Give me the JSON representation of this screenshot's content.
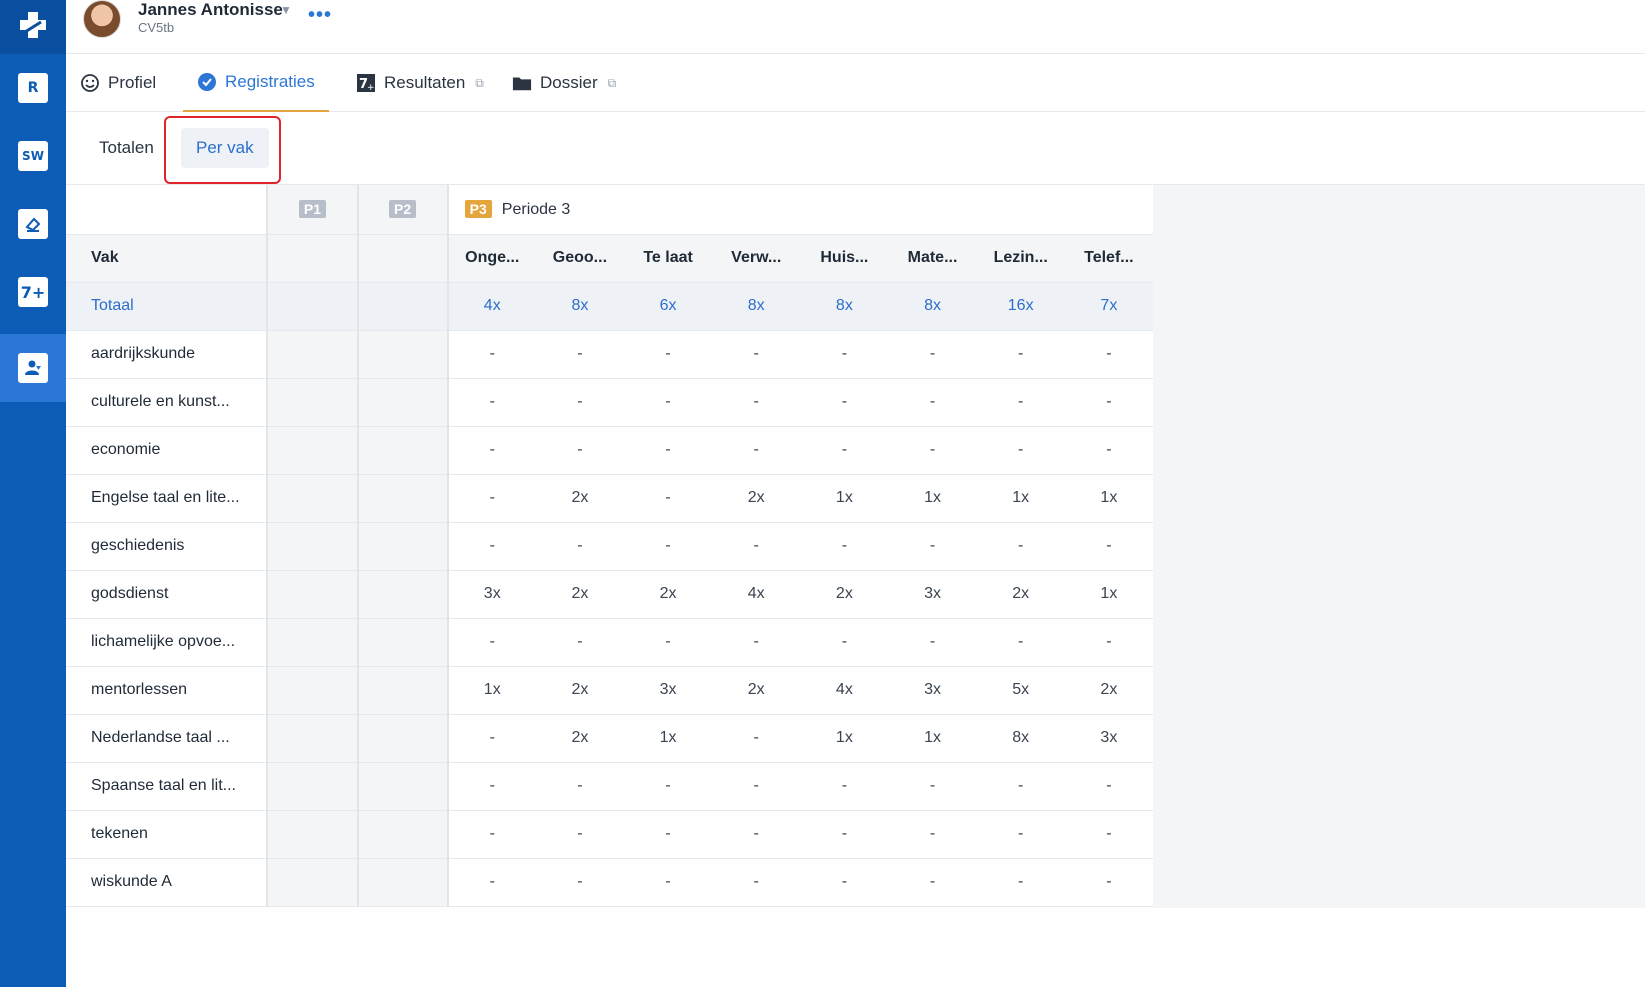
{
  "header": {
    "user_name": "Jannes Antonisse",
    "user_class": "CV5tb",
    "more": "•••"
  },
  "rail": {
    "items": [
      {
        "name": "logo-icon"
      },
      {
        "name": "roster-icon",
        "label": "R"
      },
      {
        "name": "sw-icon",
        "label": "SW"
      },
      {
        "name": "eraser-icon"
      },
      {
        "name": "grades-icon",
        "label": "7+"
      },
      {
        "name": "students-icon"
      }
    ]
  },
  "tabs": [
    {
      "label": "Profiel",
      "icon": "smiley-icon"
    },
    {
      "label": "Registraties",
      "icon": "check-circle-icon"
    },
    {
      "label": "Resultaten",
      "icon": "grades-icon"
    },
    {
      "label": "Dossier",
      "icon": "folder-icon"
    }
  ],
  "subtabs": [
    {
      "label": "Totalen"
    },
    {
      "label": "Per vak"
    }
  ],
  "table": {
    "periods": {
      "p1": "P1",
      "p2": "P2",
      "p3": "P3",
      "p3_label": "Periode 3"
    },
    "vak_header": "Vak",
    "columns": [
      "Onge...",
      "Geoo...",
      "Te laat",
      "Verw...",
      "Huis...",
      "Mate...",
      "Lezin...",
      "Telef..."
    ],
    "total": {
      "label": "Totaal",
      "values": [
        "4x",
        "8x",
        "6x",
        "8x",
        "8x",
        "8x",
        "16x",
        "7x"
      ]
    },
    "rows": [
      {
        "vak": "aardrijkskunde",
        "values": [
          "-",
          "-",
          "-",
          "-",
          "-",
          "-",
          "-",
          "-"
        ]
      },
      {
        "vak": "culturele en kunst...",
        "values": [
          "-",
          "-",
          "-",
          "-",
          "-",
          "-",
          "-",
          "-"
        ]
      },
      {
        "vak": "economie",
        "values": [
          "-",
          "-",
          "-",
          "-",
          "-",
          "-",
          "-",
          "-"
        ]
      },
      {
        "vak": "Engelse taal en lite...",
        "values": [
          "-",
          "2x",
          "-",
          "2x",
          "1x",
          "1x",
          "1x",
          "1x"
        ]
      },
      {
        "vak": "geschiedenis",
        "values": [
          "-",
          "-",
          "-",
          "-",
          "-",
          "-",
          "-",
          "-"
        ]
      },
      {
        "vak": "godsdienst",
        "values": [
          "3x",
          "2x",
          "2x",
          "4x",
          "2x",
          "3x",
          "2x",
          "1x"
        ]
      },
      {
        "vak": "lichamelijke opvoe...",
        "values": [
          "-",
          "-",
          "-",
          "-",
          "-",
          "-",
          "-",
          "-"
        ]
      },
      {
        "vak": "mentorlessen",
        "values": [
          "1x",
          "2x",
          "3x",
          "2x",
          "4x",
          "3x",
          "5x",
          "2x"
        ]
      },
      {
        "vak": "Nederlandse taal ...",
        "values": [
          "-",
          "2x",
          "1x",
          "-",
          "1x",
          "1x",
          "8x",
          "3x"
        ]
      },
      {
        "vak": "Spaanse taal en lit...",
        "values": [
          "-",
          "-",
          "-",
          "-",
          "-",
          "-",
          "-",
          "-"
        ]
      },
      {
        "vak": "tekenen",
        "values": [
          "-",
          "-",
          "-",
          "-",
          "-",
          "-",
          "-",
          "-"
        ]
      },
      {
        "vak": "wiskunde A",
        "values": [
          "-",
          "-",
          "-",
          "-",
          "-",
          "-",
          "-",
          "-"
        ]
      }
    ]
  },
  "colors": {
    "primary": "#0c5bb5",
    "accent": "#2c77d6",
    "period3": "#e3a53c",
    "highlight": "#e0242b"
  }
}
